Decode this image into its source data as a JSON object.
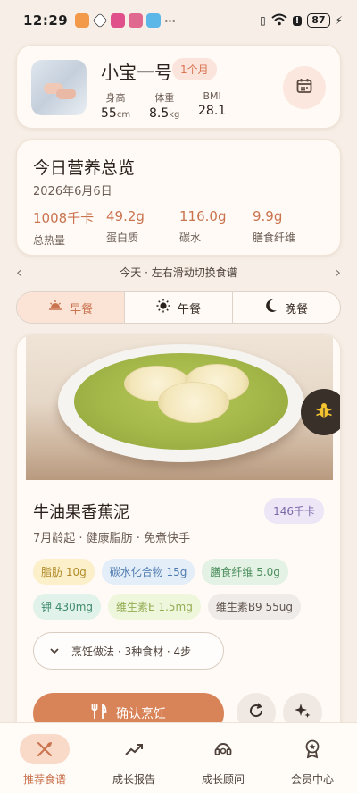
{
  "status_bar": {
    "time": "12:29",
    "more": "···",
    "battery": "87"
  },
  "profile": {
    "name": "小宝一号",
    "age": "1个月",
    "stats": [
      {
        "label": "身高",
        "value": "55",
        "unit": "cm"
      },
      {
        "label": "体重",
        "value": "8.5",
        "unit": "kg"
      },
      {
        "label": "BMI",
        "value": "28.1",
        "unit": ""
      }
    ]
  },
  "nutrition": {
    "title": "今日营养总览",
    "date": "2026年6月6日",
    "items": [
      {
        "value": "1008千卡",
        "label": "总热量"
      },
      {
        "value": "49.2g",
        "label": "蛋白质"
      },
      {
        "value": "116.0g",
        "label": "碳水"
      },
      {
        "value": "9.9g",
        "label": "膳食纤维"
      }
    ]
  },
  "swipe_hint": "今天 · 左右滑动切换食谱",
  "meal_tabs": [
    {
      "label": "早餐",
      "icon": "sunrise-icon",
      "active": true
    },
    {
      "label": "午餐",
      "icon": "sun-icon",
      "active": false
    },
    {
      "label": "晚餐",
      "icon": "moon-icon",
      "active": false
    }
  ],
  "recipe": {
    "name": "牛油果香蕉泥",
    "kcal": "146千卡",
    "desc": "7月龄起 · 健康脂肪 · 免煮快手",
    "chips": [
      {
        "text": "脂肪 10g",
        "bg": "#fbf0c9",
        "color": "#b08a2a"
      },
      {
        "text": "碳水化合物 15g",
        "bg": "#e4eef9",
        "color": "#4f7bb0"
      },
      {
        "text": "膳食纤维 5.0g",
        "bg": "#e3f2e5",
        "color": "#4b8d5a"
      },
      {
        "text": "钾 430mg",
        "bg": "#e0f2ea",
        "color": "#3f8a6b"
      },
      {
        "text": "维生素E 1.5mg",
        "bg": "#eef6dc",
        "color": "#93ad53"
      },
      {
        "text": "维生素B9 55ug",
        "bg": "#efebe8",
        "color": "#5f534c"
      }
    ],
    "cook_toggle": "烹饪做法 · 3种食材 · 4步",
    "confirm_label": "确认烹饪"
  },
  "bottom_nav": [
    {
      "label": "推荐食谱",
      "icon": "utensils-icon",
      "active": true
    },
    {
      "label": "成长报告",
      "icon": "trend-icon",
      "active": false
    },
    {
      "label": "成长顾问",
      "icon": "advisor-icon",
      "active": false
    },
    {
      "label": "会员中心",
      "icon": "member-badge-icon",
      "active": false
    }
  ],
  "colors": {
    "accent": "#d98458",
    "accent_text": "#c9734f",
    "background": "#f7efe7"
  }
}
